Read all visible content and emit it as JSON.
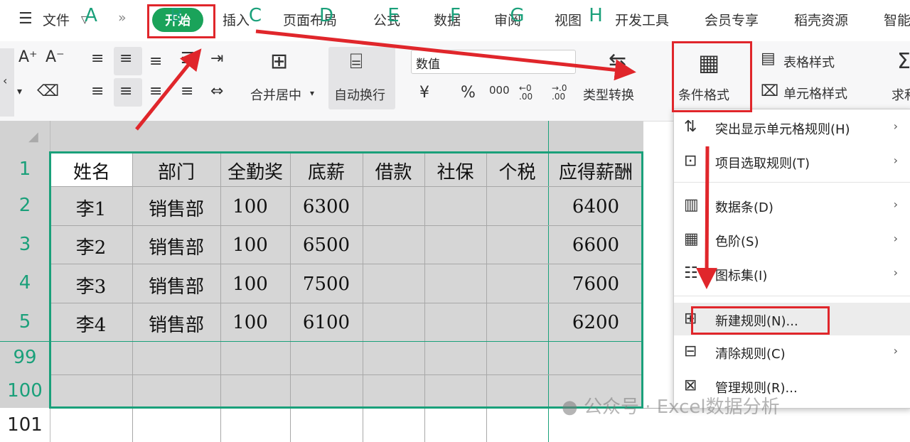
{
  "menu_bar": {
    "hamburger": "☰",
    "file_label": "文件",
    "more": "»",
    "tabs": [
      "开始",
      "插入",
      "页面布局",
      "公式",
      "数据",
      "审阅",
      "视图",
      "开发工具",
      "会员专享",
      "稻壳资源",
      "智能"
    ]
  },
  "ribbon": {
    "font_grow": "A⁺",
    "font_shrink": "A⁻",
    "merge_center": "合并居中",
    "wrap_text": "自动换行",
    "number_format": "数值",
    "currency": "¥",
    "percent": "%",
    "thousands": "000",
    "dec_inc": "←0 .00",
    "dec_dec": "→.0 .00",
    "type_convert": "类型转换",
    "conditional_format": "条件格式",
    "table_style": "表格样式",
    "cell_style": "单元格样式",
    "sum_partial": "求和"
  },
  "columns": [
    "A",
    "B",
    "C",
    "D",
    "E",
    "F",
    "G",
    "H"
  ],
  "rows": [
    "1",
    "2",
    "3",
    "4",
    "5",
    "99",
    "100",
    "101"
  ],
  "table": {
    "headers": [
      "姓名",
      "部门",
      "全勤奖",
      "底薪",
      "借款",
      "社保",
      "个税",
      "应得薪酬"
    ],
    "data": [
      [
        "李1",
        "销售部",
        "100",
        "6300",
        "",
        "",
        "",
        "6400"
      ],
      [
        "李2",
        "销售部",
        "100",
        "6500",
        "",
        "",
        "",
        "6600"
      ],
      [
        "李3",
        "销售部",
        "100",
        "7500",
        "",
        "",
        "",
        "7600"
      ],
      [
        "李4",
        "销售部",
        "100",
        "6100",
        "",
        "",
        "",
        "6200"
      ]
    ]
  },
  "context_menu": [
    {
      "label": "突出显示单元格规则(H)",
      "icon": "highlight-rules-icon",
      "submenu": true
    },
    {
      "label": "项目选取规则(T)",
      "icon": "top-bottom-rules-icon",
      "submenu": true
    },
    {
      "label": "数据条(D)",
      "icon": "data-bars-icon",
      "submenu": true
    },
    {
      "label": "色阶(S)",
      "icon": "color-scales-icon",
      "submenu": true
    },
    {
      "label": "图标集(I)",
      "icon": "icon-sets-icon",
      "submenu": true
    },
    {
      "label": "新建规则(N)...",
      "icon": "new-rule-icon",
      "submenu": false
    },
    {
      "label": "清除规则(C)",
      "icon": "clear-rules-icon",
      "submenu": true
    },
    {
      "label": "管理规则(R)...",
      "icon": "manage-rules-icon",
      "submenu": false
    }
  ],
  "watermark": "公众号 · Excel数据分析",
  "colors": {
    "accent": "#1aa35a",
    "highlight": "#e0262b",
    "grid_header": "#1aa07a"
  }
}
